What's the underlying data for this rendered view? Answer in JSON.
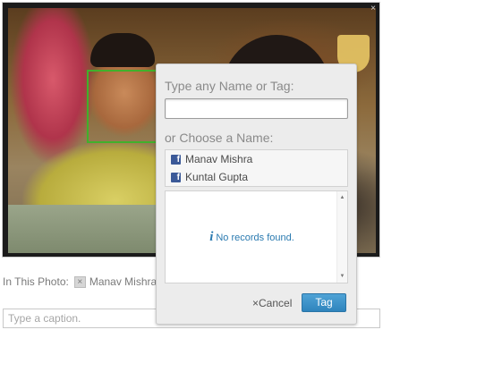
{
  "photo": {
    "close_glyph": "×",
    "face_box_color": "#41b02b"
  },
  "tagged": {
    "label": "In This Photo:",
    "remove_glyph": "×",
    "name": "Manav Mishra"
  },
  "caption": {
    "placeholder": "Type a caption.",
    "value": ""
  },
  "popup": {
    "heading_type": "Type any Name or Tag:",
    "name_input_value": "",
    "heading_choose": "or Choose a Name:",
    "names": [
      {
        "label": "Manav Mishra",
        "icon": "facebook-icon"
      },
      {
        "label": "Kuntal Gupta",
        "icon": "facebook-icon"
      }
    ],
    "no_records": "No records found.",
    "info_glyph": "i",
    "cancel_label": "×Cancel",
    "tag_button_label": "Tag",
    "accent_color": "#2f84bd"
  }
}
